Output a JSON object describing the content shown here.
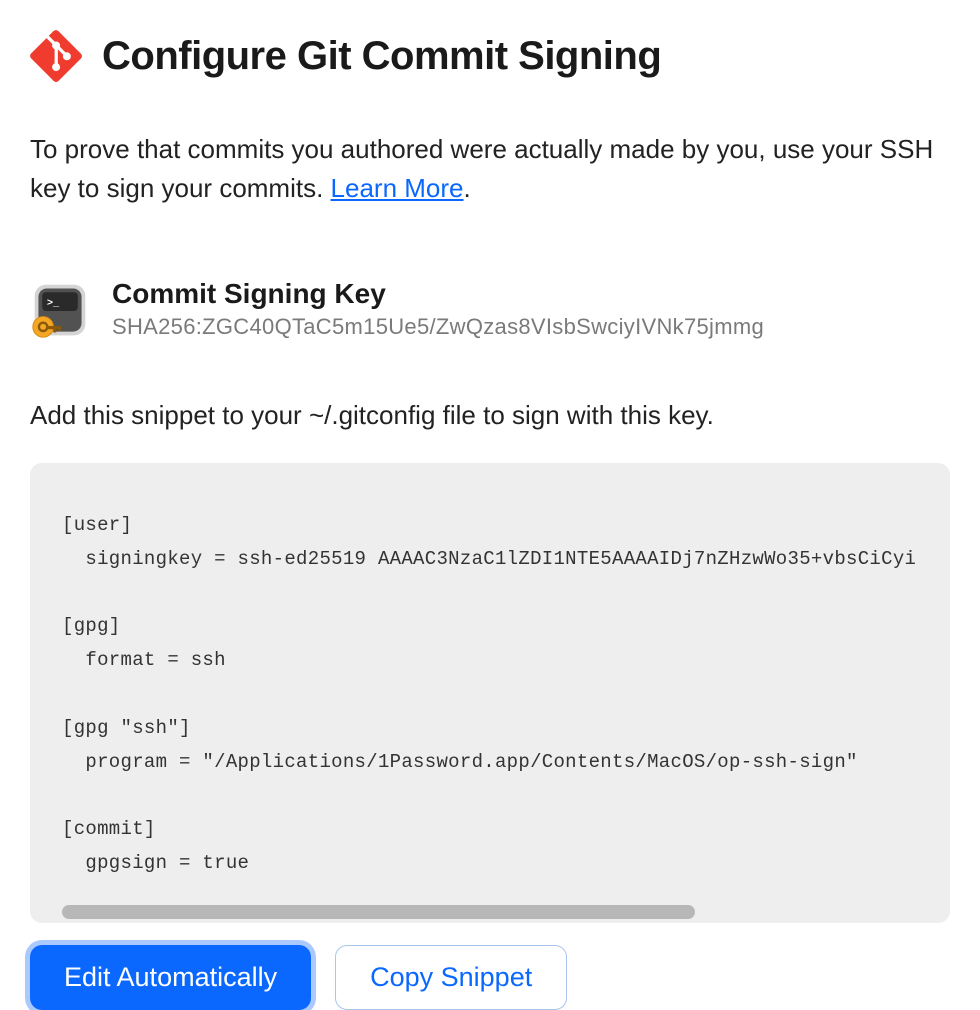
{
  "header": {
    "title": "Configure Git Commit Signing"
  },
  "description": {
    "text_before_link": "To prove that commits you authored were actually made by you, use your SSH key to sign your commits. ",
    "link_text": "Learn More",
    "text_after_link": "."
  },
  "key": {
    "title": "Commit Signing Key",
    "fingerprint": "SHA256:ZGC40QTaC5m15Ue5/ZwQzas8VIsbSwciyIVNk75jmmg"
  },
  "snippet": {
    "instructions": "Add this snippet to your ~/.gitconfig file to sign with this key.",
    "code": "[user]\n  signingkey = ssh-ed25519 AAAAC3NzaC1lZDI1NTE5AAAAIDj7nZHzwWo35+vbsCiCyi\n\n[gpg]\n  format = ssh\n\n[gpg \"ssh\"]\n  program = \"/Applications/1Password.app/Contents/MacOS/op-ssh-sign\"\n\n[commit]\n  gpgsign = true"
  },
  "buttons": {
    "edit_automatically": "Edit Automatically",
    "copy_snippet": "Copy Snippet"
  }
}
